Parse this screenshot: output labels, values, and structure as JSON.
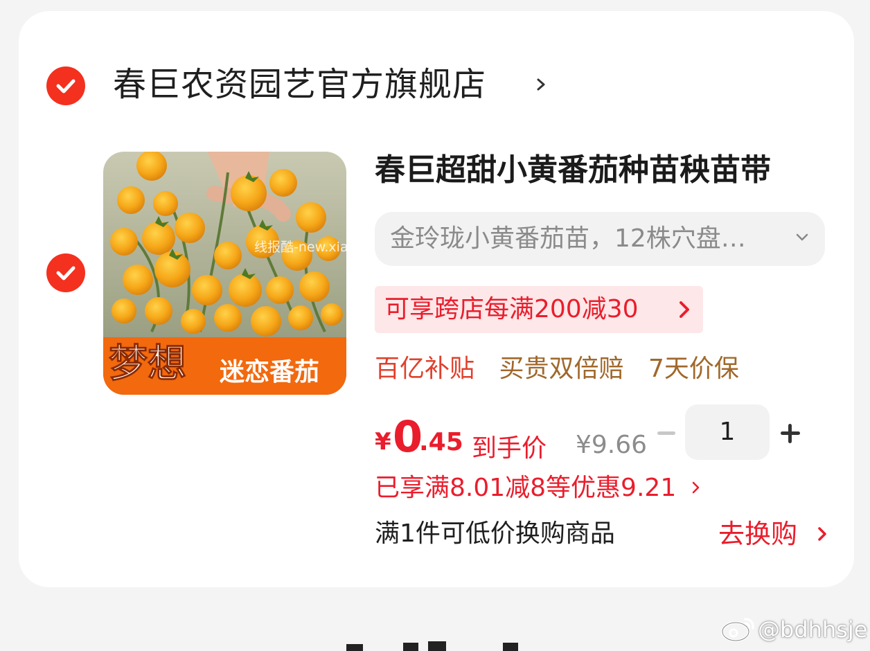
{
  "shop": {
    "name": "春巨农资园艺官方旗舰店"
  },
  "item": {
    "title": "春巨超甜小黄番茄种苗秧苗带",
    "variant": "金玲珑小黄番茄苗，12株穴盘…",
    "image_caption": "梦想迷恋番茄",
    "watermark": "线报酷-new.xianbao.fun",
    "promo": "可享跨店每满200减30",
    "tags": {
      "subsidy": "百亿补贴",
      "compensate": "买贵双倍赔",
      "price_protect": "7天价保"
    },
    "price": {
      "currency": "¥",
      "integer": "0",
      "decimal": ".45",
      "label": "到手价",
      "original": "¥9.66"
    },
    "quantity": "1",
    "discount": "已享满8.01减8等优惠9.21",
    "exchange_text": "满1件可低价换购商品",
    "exchange_link": "去换购"
  },
  "weibo": {
    "handle": "@bdhhsje"
  },
  "colors": {
    "accent_red": "#ea1d2c",
    "check_red": "#f4301f",
    "gold": "#a0682b"
  }
}
